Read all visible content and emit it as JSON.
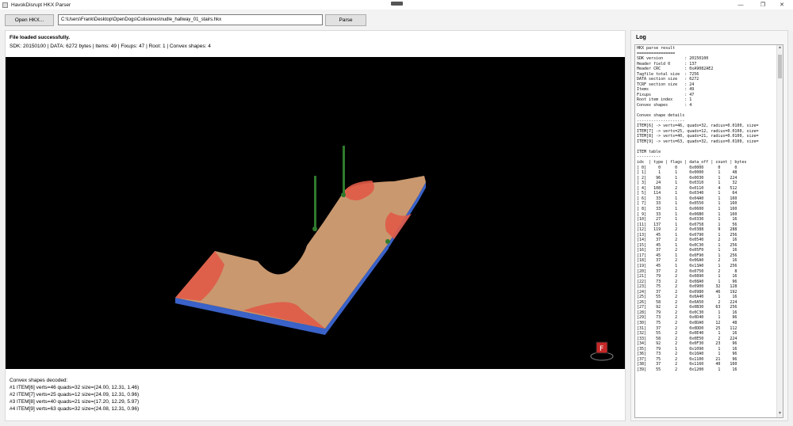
{
  "window": {
    "title": "HavokDisrupt HKX Parser",
    "minimize_glyph": "—",
    "maximize_glyph": "❐",
    "close_glyph": "✕"
  },
  "toolbar": {
    "open_label": "Open HKX...",
    "path_value": "C:\\Users\\Frank\\Desktop\\OpenDogs\\Colisiones\\nudle_hallway_01_stairs.hkx",
    "parse_label": "Parse"
  },
  "status": {
    "message": "File loaded successfully.",
    "info": "SDK: 20150100 | DATA: 6272 bytes | Items: 49 | Fixups: 47 | Root: 1 | Convex shapes: 4"
  },
  "viewport": {
    "gizmo_label": "F",
    "colors": {
      "floor": "#c9986f",
      "edge": "#e05a47",
      "side": "#3a62c8",
      "post": "#2f7a2e",
      "background": "#000000"
    }
  },
  "decoded": {
    "heading": "Convex shapes decoded:",
    "lines": [
      "#1 ITEM[6] verts=46 quads=32 size=(24.00, 12.31, 1.46)",
      "#2 ITEM[7] verts=25 quads=12 size=(24.09, 12.31, 0.96)",
      "#3 ITEM[8] verts=40 quads=21 size=(17.20, 12.29, 5.97)",
      "#4 ITEM[9] verts=63 quads=32 size=(24.08, 12.31, 0.96)"
    ]
  },
  "log": {
    "heading": "Log",
    "lines": [
      "HKX parse result",
      "================",
      "SDK version         : 20150100",
      "Header field 0      : 137",
      "Header CRC          : 0xA9082AE2",
      "Tagfile total size  : 7256",
      "DATA section size   : 6272",
      "TCRF section size   : 24",
      "Items               : 49",
      "Fixups              : 47",
      "Root item index     : 1",
      "Convex shapes       : 4",
      "",
      "Convex shape details",
      "--------------------",
      "ITEM[6] -> verts=46, quads=32, radius=0.0100, size=",
      "ITEM[7] -> verts=25, quads=12, radius=0.0100, size=",
      "ITEM[8] -> verts=40, quads=21, radius=0.0100, size=",
      "ITEM[9] -> verts=63, quads=32, radius=0.0100, size=",
      "",
      "ITEM table",
      "----------",
      "idx  | type | flags | data_off | count | bytes",
      "[ 0]     0      0     0x0000      0      0",
      "[ 1]     1      1     0x0000      1     48",
      "[ 2]    96      1     0x0030      1    224",
      "[ 3]    24      1     0x0310      1     32",
      "[ 4]   108      2     0x0110      4    512",
      "[ 5]   114      1     0x0340      1     64",
      "[ 6]    33      1     0x04A0      1    160",
      "[ 7]    33      1     0x0550      1    160",
      "[ 8]    33      1     0x0600      1    160",
      "[ 9]    33      1     0x06B0      1    160",
      "[10]    27      1     0x0330      1     16",
      "[11]   137      1     0x0758      1     56",
      "[12]   119      2     0x0388      9    288",
      "[13]    45      1     0x0790      1    256",
      "[14]    37      2     0x0540      2     16",
      "[15]    45      1     0x0C30      1    256",
      "[16]    37      2     0x05F0      1     16",
      "[17]    45      1     0x0F90      1    256",
      "[18]    37      2     0x06A0      2     16",
      "[19]    45      1     0x13A0      1    256",
      "[20]    37      2     0x0750      2      8",
      "[21]    79      2     0x0890      1     16",
      "[22]    73      2     0x08A0      1     96",
      "[23]    75      2     0x0900     32    128",
      "[24]    37      2     0x0980     46    192",
      "[25]    55      2     0x0A40      1     16",
      "[26]    58      2     0x0A50      2    224",
      "[27]    92      2     0x0B30     63    256",
      "[28]    79      2     0x0C30      1     16",
      "[29]    73      2     0x0D40      1     96",
      "[30]    75      2     0x0DA0     12     48",
      "[31]    37      2     0x0DD0     25    112",
      "[32]    55      2     0x0E40      1     16",
      "[33]    58      2     0x0E50      2    224",
      "[34]    92      2     0x0F30     23     96",
      "[35]    79      1     0x1090      1     16",
      "[36]    73      2     0x10A0      1     96",
      "[37]    75      2     0x1100     21     96",
      "[38]    37      2     0x1160     40    160",
      "[39]    55      2     0x1200      1     16"
    ]
  }
}
